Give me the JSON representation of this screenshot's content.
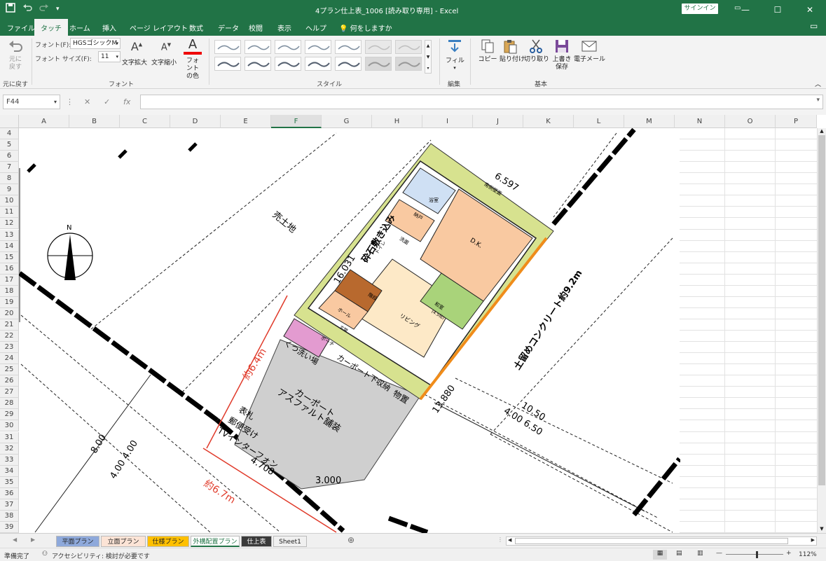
{
  "window": {
    "title": "4プラン仕上表_1006 [読み取り専用] - Excel",
    "signin": "サインイン",
    "min_icon": "minimize-icon",
    "max_icon": "maximize-icon",
    "close_icon": "close-icon"
  },
  "tabs": [
    {
      "label": "ファイル"
    },
    {
      "label": "タッチ",
      "active": true
    },
    {
      "label": "ホーム"
    },
    {
      "label": "挿入"
    },
    {
      "label": "ページ レイアウト"
    },
    {
      "label": "数式"
    },
    {
      "label": "データ"
    },
    {
      "label": "校閲"
    },
    {
      "label": "表示"
    },
    {
      "label": "ヘルプ"
    }
  ],
  "tell_me": "何をしますか",
  "ribbon": {
    "undo": {
      "label": "元に戻す",
      "group": "元に戻す"
    },
    "font_label": "フォント(F):",
    "font_value": "HGSゴシックM",
    "size_label": "フォント サイズ(F):",
    "size_value": "11",
    "font_grow": "文字拡大",
    "font_shrink": "文字縮小",
    "font_color": "フォントの色",
    "font_group": "フォント",
    "styles_group": "スタイル",
    "fill": "フィル",
    "edit_group": "編集",
    "copy": "コピー",
    "paste": "貼り付け",
    "cut": "切り取り",
    "save": "上書き保存",
    "email": "電子メール",
    "basic_group": "基本"
  },
  "formula_bar": {
    "name_box": "F44",
    "formula": ""
  },
  "columns": [
    "A",
    "B",
    "C",
    "D",
    "E",
    "F",
    "G",
    "H",
    "I",
    "J",
    "K",
    "L",
    "M",
    "N",
    "O",
    "P"
  ],
  "selected_column": "F",
  "rows": [
    "4",
    "5",
    "6",
    "7",
    "8",
    "9",
    "10",
    "11",
    "12",
    "13",
    "14",
    "15",
    "16",
    "17",
    "18",
    "19",
    "20",
    "21",
    "22",
    "23",
    "24",
    "25",
    "26",
    "27",
    "28",
    "29",
    "30",
    "31",
    "32",
    "33",
    "34",
    "35",
    "36",
    "37",
    "38",
    "39"
  ],
  "drawing": {
    "north": "N",
    "neighbor": "売土地",
    "rooms": {
      "bath": "浴室",
      "wash": "洗面",
      "toilet": "トイレ",
      "storage": "納戸",
      "dk": "D.K.",
      "washitsu": "和室",
      "washitsu_size": "(4.5帖)",
      "hall": "ホール",
      "living": "リビング",
      "stairs": "階段",
      "genkan": "玄関",
      "porch": "ポーチ",
      "mono": "物置"
    },
    "labels": {
      "gravel": "砕石敷き込み",
      "concrete": "土留めコンクリート約9.2m",
      "carport1": "カーポート",
      "carport2": "アスファルト舗装",
      "shoe": "くつ洗い場",
      "carport_storage": "カーポート下収納",
      "post1": "表札",
      "post2": "郵便受け",
      "post3": "TVインターフォン",
      "wall": "南側壁面"
    },
    "dims": {
      "top": "6.597",
      "left": "16.031",
      "bottom": "13.880",
      "d4708": "4.708",
      "d3000": "3.000",
      "red1": "約6.4m",
      "red2": "約6.7m",
      "road1": "8.00",
      "road2": "4.00  4.00",
      "road3": "10.50",
      "road4": "4.00  6.50"
    }
  },
  "sheets": [
    {
      "label": "平面プラン",
      "color": "#8ea9db"
    },
    {
      "label": "立面プラン",
      "color": "#fce4d6"
    },
    {
      "label": "仕様プラン",
      "color": "#ffc000"
    },
    {
      "label": "外構配置プラン",
      "color": "#e2efda"
    },
    {
      "label": "仕上表",
      "color": "#3a3a3a"
    },
    {
      "label": "Sheet1",
      "color": "#f0f0f0"
    }
  ],
  "active_sheet": "外構配置プラン",
  "status": {
    "ready": "準備完了",
    "accessibility": "アクセシビリティ: 検討が必要です",
    "zoom": "112%"
  }
}
